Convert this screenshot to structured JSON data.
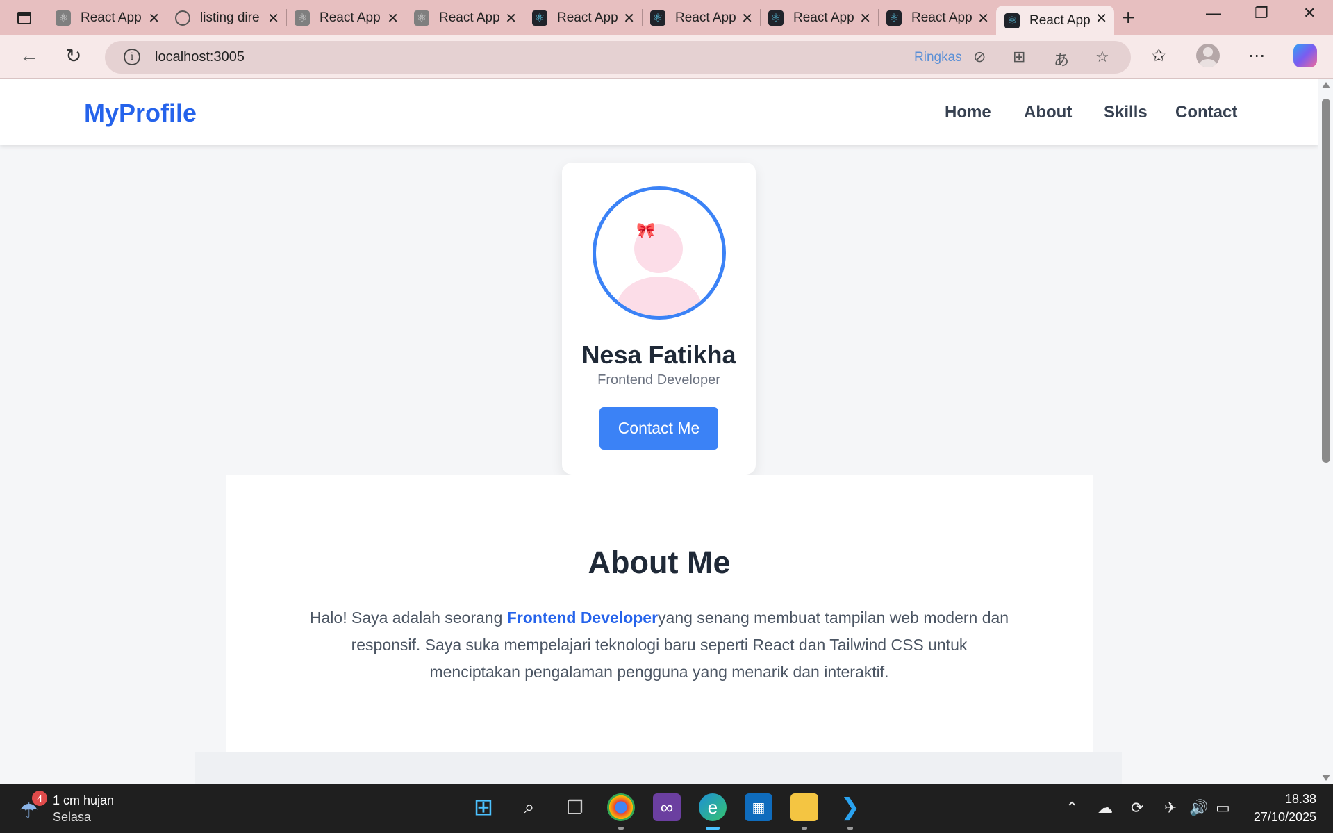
{
  "browser": {
    "tabs": [
      {
        "label": "React App",
        "icon": "react-gray-icon"
      },
      {
        "label": "listing dire",
        "icon": "globe-icon"
      },
      {
        "label": "React App",
        "icon": "react-gray-icon"
      },
      {
        "label": "React App",
        "icon": "react-gray-icon"
      },
      {
        "label": "React App",
        "icon": "react-icon"
      },
      {
        "label": "React App",
        "icon": "react-icon"
      },
      {
        "label": "React App",
        "icon": "react-icon"
      },
      {
        "label": "React App",
        "icon": "react-icon"
      },
      {
        "label": "React App",
        "icon": "react-icon",
        "active": true
      }
    ],
    "address": "localhost:3005",
    "summarize_label": "Ringkas"
  },
  "site": {
    "brand": "MyProfile",
    "nav": [
      "Home",
      "About",
      "Skills",
      "Contact"
    ],
    "profile": {
      "name": "Nesa Fatikha",
      "role": "Frontend Developer",
      "button": "Contact Me"
    },
    "about": {
      "heading": "About Me",
      "text_before": "Halo! Saya adalah seorang ",
      "highlight": "Frontend Developer",
      "text_after": "yang senang membuat tampilan web modern dan responsif. Saya suka mempelajari teknologi baru seperti React dan Tailwind CSS untuk menciptakan pengalaman pengguna yang menarik dan interaktif."
    }
  },
  "taskbar": {
    "weather": {
      "badge": "4",
      "text": "1 cm hujan",
      "sub": "Selasa"
    },
    "time": "18.38",
    "date": "27/10/2025"
  },
  "colors": {
    "brand": "#2563eb",
    "button": "#3b82f6",
    "tabstrip": "#e7bfc0",
    "avatar_pink": "#fcdde8"
  }
}
